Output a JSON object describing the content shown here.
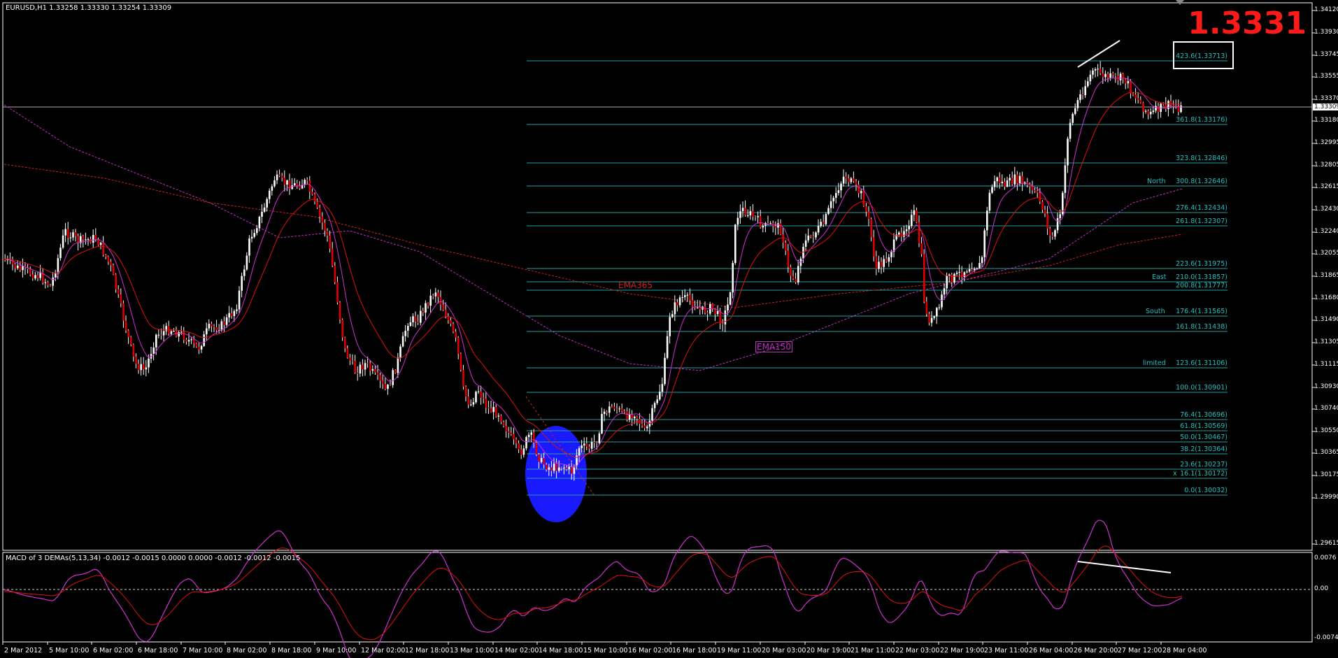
{
  "chart": {
    "symbol_info": "EURUSD,H1  1.33258 1.33330 1.33254 1.33309",
    "big_price": "1.3331",
    "current_price_tag": "1.33309",
    "price_axis_labels": [
      "1.34120",
      "1.33930",
      "1.33745",
      "1.33555",
      "1.33370",
      "1.33180",
      "1.32995",
      "1.32805",
      "1.32615",
      "1.32430",
      "1.32240",
      "1.32055",
      "1.31865",
      "1.31680",
      "1.31490",
      "1.31305",
      "1.31115",
      "1.30930",
      "1.30740",
      "1.30550",
      "1.30365",
      "1.30175",
      "1.29990",
      "1.29615"
    ],
    "time_axis_labels": [
      "2 Mar 2012",
      "5 Mar 10:00",
      "6 Mar 02:00",
      "6 Mar 18:00",
      "7 Mar 10:00",
      "8 Mar 02:00",
      "8 Mar 18:00",
      "9 Mar 10:00",
      "12 Mar 02:00",
      "12 Mar 18:00",
      "13 Mar 10:00",
      "14 Mar 02:00",
      "14 Mar 18:00",
      "15 Mar 10:00",
      "16 Mar 02:00",
      "16 Mar 18:00",
      "19 Mar 11:00",
      "20 Mar 03:00",
      "20 Mar 19:00",
      "21 Mar 11:00",
      "22 Mar 03:00",
      "22 Mar 19:00",
      "23 Mar 11:00",
      "26 Mar 04:00",
      "26 Mar 20:00",
      "27 Mar 12:00",
      "28 Mar 04:00"
    ],
    "ema_labels": {
      "ema365": "EMA365",
      "ema150": "EMA150"
    },
    "colors": {
      "background": "#000000",
      "fib": "#20c0c0",
      "ema365": "#cc2020",
      "ema150": "#c030c0",
      "big_price": "#ff1a1a",
      "ellipse": "#1a1aff"
    }
  },
  "fibonacci": [
    {
      "label": "423.6(1.33713)",
      "tag": ""
    },
    {
      "label": "361.8(1.33176)",
      "tag": ""
    },
    {
      "label": "323.8(1.32846)",
      "tag": ""
    },
    {
      "label": "300.8(1.32646)",
      "tag": "North"
    },
    {
      "label": "276.4(1.32434)",
      "tag": ""
    },
    {
      "label": "261.8(1.32307)",
      "tag": ""
    },
    {
      "label": "223.6(1.31975)",
      "tag": ""
    },
    {
      "label": "210.0(1.31857)",
      "tag": "East"
    },
    {
      "label": "200.8(1.31777)",
      "tag": ""
    },
    {
      "label": "176.4(1.31565)",
      "tag": "South"
    },
    {
      "label": "161.8(1.31438)",
      "tag": ""
    },
    {
      "label": "123.6(1.31106)",
      "tag": "limited"
    },
    {
      "label": "100.0(1.30901)",
      "tag": ""
    },
    {
      "label": "76.4(1.30696)",
      "tag": ""
    },
    {
      "label": "61.8(1.30569)",
      "tag": ""
    },
    {
      "label": "50.0(1.30467)",
      "tag": ""
    },
    {
      "label": "38.2(1.30364)",
      "tag": ""
    },
    {
      "label": "23.6(1.30237)",
      "tag": ""
    },
    {
      "label": "16.1(1.30172)",
      "tag": "x"
    },
    {
      "label": "0.0(1.30032)",
      "tag": ""
    }
  ],
  "macd": {
    "info": "MACD of 3 DEMAs(5,13,34) -0.0012 -0.0015 0.0000 0.0000 -0.0012 -0.0012 -0.0015",
    "axis_labels": [
      "0.0076",
      "0.00",
      "-0.0074"
    ]
  }
}
